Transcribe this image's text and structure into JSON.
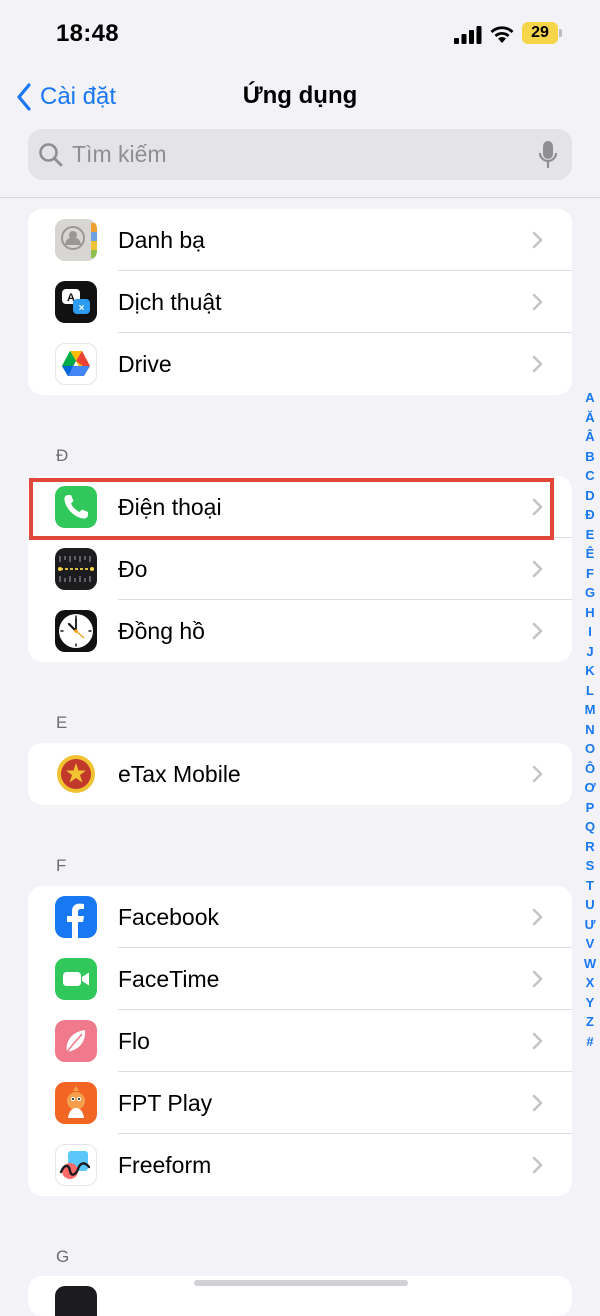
{
  "status_bar": {
    "time": "18:48",
    "battery": "29",
    "icons": [
      "signal-icon",
      "wifi-icon",
      "battery-icon"
    ]
  },
  "nav": {
    "back_label": "Cài đặt",
    "title": "Ứng dụng"
  },
  "search": {
    "placeholder": "Tìm kiếm"
  },
  "sections": [
    {
      "header": "",
      "items": [
        {
          "label": "Danh bạ",
          "icon": "contacts-icon"
        },
        {
          "label": "Dịch thuật",
          "icon": "translate-icon"
        },
        {
          "label": "Drive",
          "icon": "google-drive-icon"
        }
      ]
    },
    {
      "header": "Đ",
      "items": [
        {
          "label": "Điện thoại",
          "icon": "phone-icon"
        },
        {
          "label": "Đo",
          "icon": "measure-icon"
        },
        {
          "label": "Đồng hồ",
          "icon": "clock-icon"
        }
      ]
    },
    {
      "header": "E",
      "items": [
        {
          "label": "eTax Mobile",
          "icon": "etax-icon"
        }
      ]
    },
    {
      "header": "F",
      "items": [
        {
          "label": "Facebook",
          "icon": "facebook-icon"
        },
        {
          "label": "FaceTime",
          "icon": "facetime-icon"
        },
        {
          "label": "Flo",
          "icon": "flo-icon"
        },
        {
          "label": "FPT Play",
          "icon": "fpt-play-icon"
        },
        {
          "label": "Freeform",
          "icon": "freeform-icon"
        }
      ]
    },
    {
      "header": "G",
      "items": []
    }
  ],
  "index": [
    "A",
    "Ă",
    "Â",
    "B",
    "C",
    "D",
    "Đ",
    "E",
    "Ê",
    "F",
    "G",
    "H",
    "I",
    "J",
    "K",
    "L",
    "M",
    "N",
    "O",
    "Ô",
    "Ơ",
    "P",
    "Q",
    "R",
    "S",
    "T",
    "U",
    "Ư",
    "V",
    "W",
    "X",
    "Y",
    "Z",
    "#"
  ],
  "colors": {
    "accent": "#1877f2",
    "highlight": "#e0493a",
    "background": "#f2f2f7"
  }
}
